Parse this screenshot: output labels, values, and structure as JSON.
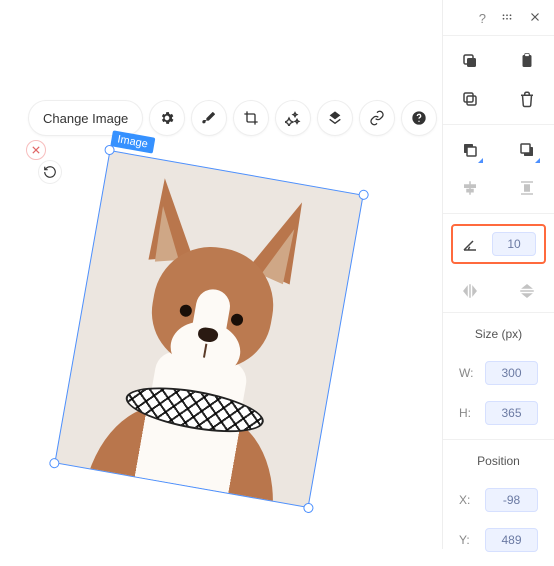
{
  "toolbar": {
    "change_label": "Change Image"
  },
  "selection": {
    "tag": "Image"
  },
  "panel": {
    "rotation": {
      "value": "10"
    },
    "size": {
      "title": "Size (px)",
      "w_label": "W:",
      "w_value": "300",
      "h_label": "H:",
      "h_value": "365"
    },
    "position": {
      "title": "Position",
      "x_label": "X:",
      "x_value": "-98",
      "y_label": "Y:",
      "y_value": "489"
    }
  }
}
